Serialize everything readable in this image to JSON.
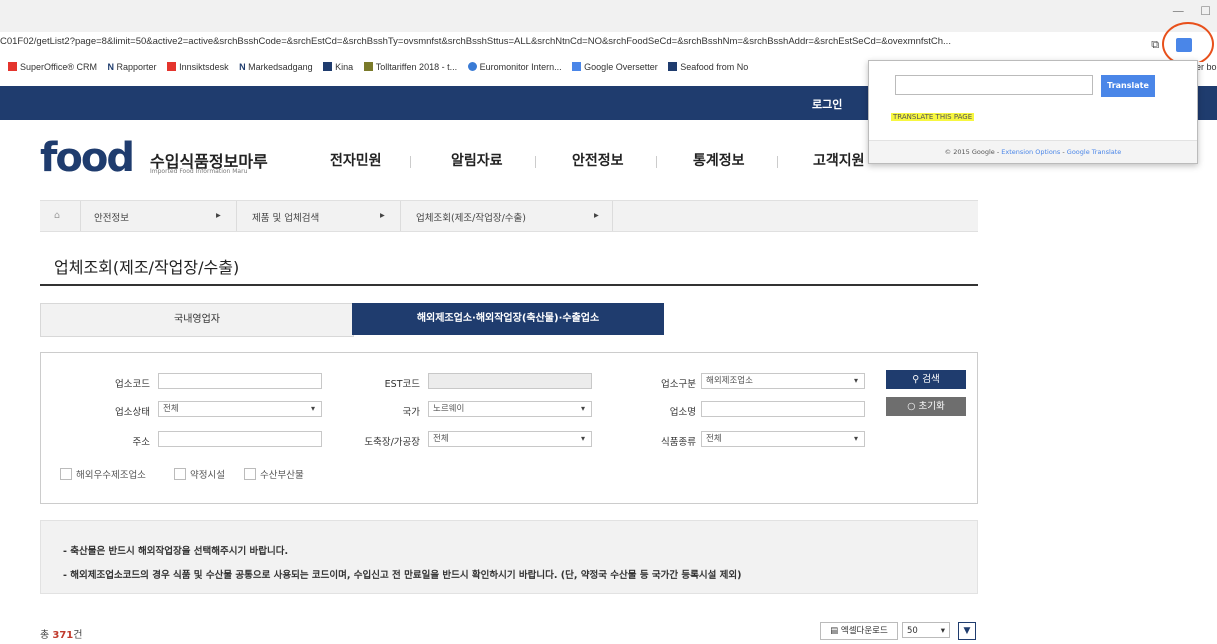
{
  "browser": {
    "url": "C01F02/getList2?page=8&limit=50&active2=active&srchBsshCode=&srchEstCd=&srchBsshTy=ovsmnfst&srchBsshSttus=ALL&srchNtnCd=NO&srchFoodSeCd=&srchBsshNm=&srchBsshAddr=&srchEstSeCd=&ovexmnfstCh...",
    "bookmarks": [
      "SuperOffice® CRM",
      "Rapporter",
      "Innsiktsdesk",
      "Markedsadgang",
      "Kina",
      "Tolltariffen 2018 - t...",
      "Euromonitor Intern...",
      "Google Oversetter",
      "Seafood from No"
    ],
    "bookmark_tail": "er bo"
  },
  "site": {
    "login": "로그인",
    "logo_text": "food",
    "logo_ko": "수입식품정보마루",
    "logo_en": "Imported Food Information Maru",
    "nav": [
      "전자민원",
      "알림자료",
      "안전정보",
      "통계정보",
      "고객지원"
    ]
  },
  "breadcrumb": [
    "안전정보",
    "제품 및 업체검색",
    "업체조회(제조/작업장/수출)"
  ],
  "page_title": "업체조회(제조/작업장/수출)",
  "tabs": [
    "국내영업자",
    "해외제조업소·해외작업장(축산물)·수출업소"
  ],
  "form": {
    "code_label": "업소코드",
    "est_label": "EST코드",
    "type_label": "업소구분",
    "type_value": "해외제조업소",
    "status_label": "업소상태",
    "status_value": "전체",
    "country_label": "국가",
    "country_value": "노르웨이",
    "name_label": "업소명",
    "addr_label": "주소",
    "facility_label": "도축장/가공장",
    "facility_value": "전체",
    "food_label": "식품종류",
    "food_value": "전체",
    "checkboxes": [
      "해외우수제조업소",
      "약정시설",
      "수산부산물"
    ],
    "search_button": "검색",
    "reset_button": "초기화"
  },
  "notice": [
    "- 축산물은 반드시 해외작업장을 선택해주시기 바랍니다.",
    "- 해외제조업소코드의 경우 식품 및 수산물 공통으로 사용되는 코드이며, 수입신고 전 만료일을 반드시 확인하시기 바랍니다. (단, 약정국 수산물 등 국가간 등록시설 제외)"
  ],
  "results": {
    "total_prefix": "총 ",
    "total_count": "371",
    "total_suffix": "건",
    "excel_button": "엑셀다운로드",
    "per_page": "50"
  },
  "translate_popup": {
    "button": "Translate",
    "page_link": "TRANSLATE THIS PAGE",
    "footer_copy": "© 2015 Google - ",
    "footer_options": "Extension Options",
    "footer_sep": " - ",
    "footer_gt": "Google Translate"
  },
  "colors": {
    "brand_navy": "#1f3c6e",
    "accent_red": "#e8501b",
    "highlight": "#f7f740"
  }
}
